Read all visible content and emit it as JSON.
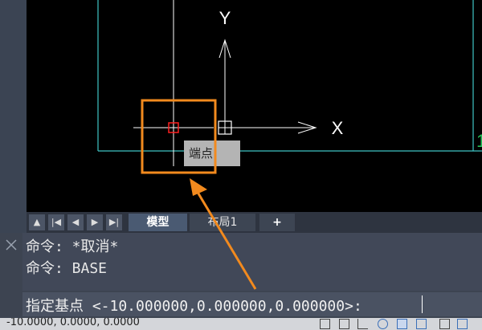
{
  "canvas": {
    "axis_x_label": "X",
    "axis_y_label": "Y",
    "snap_tooltip": "端点",
    "edge_marker": "1"
  },
  "tabs": {
    "model": "模型",
    "layout": "布局1",
    "add": "+"
  },
  "nav_buttons": [
    "▲",
    "|◀",
    "◀",
    "▶",
    "▶|"
  ],
  "command": {
    "history": [
      "命令: *取消*",
      "命令: BASE"
    ],
    "prompt": "指定基点 <-10.000000,0.000000,0.000000>:"
  },
  "status": {
    "coords": "-10.0000, 0.0000, 0.0000"
  },
  "colors": {
    "canvas_bg": "#000000",
    "boundary": "#3fc4c4",
    "crosshair": "#ffffff",
    "snap_marker": "#ff2020",
    "annotation": "#f28a1e",
    "edge_marker": "#22c35a"
  }
}
